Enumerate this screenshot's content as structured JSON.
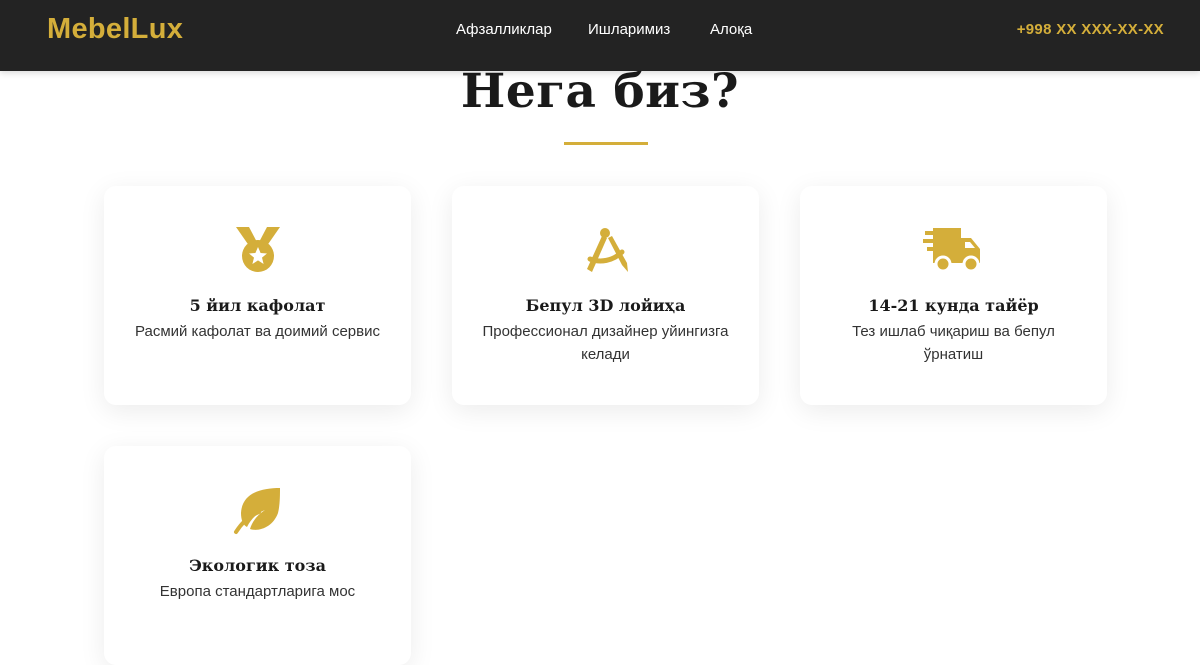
{
  "brand": {
    "name": "MebelLux",
    "accent": "#d4ae3a",
    "header_bg": "#232323"
  },
  "nav": {
    "items": [
      "Афзалликлар",
      "Ишларимиз",
      "Алоқа"
    ]
  },
  "contact": {
    "phone": "+998 XX XXX-XX-XX"
  },
  "section": {
    "title": "Нега биз?"
  },
  "features": [
    {
      "icon": "medal-icon",
      "title": "5 йил кафолат",
      "text": "Расмий кафолат ва доимий сервис"
    },
    {
      "icon": "drafting-compass-icon",
      "title": "Бепул 3D лойиҳа",
      "text": "Профессионал дизайнер уйингизга келади"
    },
    {
      "icon": "delivery-truck-icon",
      "title": "14-21 кунда тайёр",
      "text": "Тез ишлаб чиқариш ва бепул ўрнатиш"
    },
    {
      "icon": "leaf-icon",
      "title": "Экологик тоза",
      "text": "Европа стандартларига мос"
    }
  ]
}
